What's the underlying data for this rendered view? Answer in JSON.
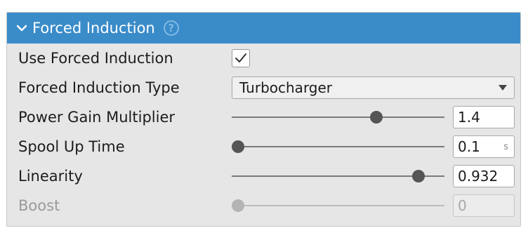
{
  "section": {
    "title": "Forced Induction",
    "expanded": true,
    "help_icon": "help-circle-icon",
    "header_color": "#3a8cc9"
  },
  "fields": {
    "use_forced_induction": {
      "label": "Use Forced Induction",
      "checked": true
    },
    "forced_induction_type": {
      "label": "Forced Induction Type",
      "value": "Turbocharger"
    },
    "power_gain_multiplier": {
      "label": "Power Gain Multiplier",
      "value": "1.4",
      "slider_fraction": 0.69
    },
    "spool_up_time": {
      "label": "Spool Up Time",
      "value": "0.1",
      "unit": "s",
      "slider_fraction": 0.0
    },
    "linearity": {
      "label": "Linearity",
      "value": "0.932",
      "slider_fraction": 0.9
    },
    "boost": {
      "label": "Boost",
      "value": "0",
      "slider_fraction": 0.0,
      "disabled": true
    }
  }
}
